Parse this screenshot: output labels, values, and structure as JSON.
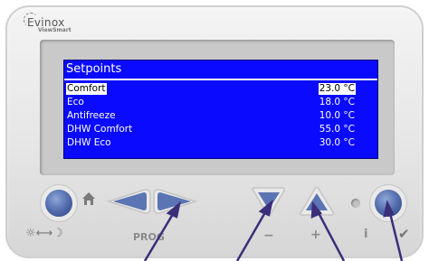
{
  "brand": {
    "name": "Evinox",
    "sub": "ViewSmart"
  },
  "screen": {
    "title": "Setpoints",
    "rows": [
      {
        "label": "Comfort",
        "value": "23.0 °C",
        "selected": true
      },
      {
        "label": "Eco",
        "value": "18.0 °C",
        "selected": false
      },
      {
        "label": "Antifreeze",
        "value": "10.0 °C",
        "selected": false
      },
      {
        "label": "DHW Comfort",
        "value": "55.0 °C",
        "selected": false
      },
      {
        "label": "DHW Eco",
        "value": "30.0 °C",
        "selected": false
      }
    ]
  },
  "labels": {
    "prog": "PROG",
    "minus": "−",
    "plus": "+",
    "info": "i",
    "check": "✔",
    "day_night": "☼⟷☽"
  },
  "colors": {
    "lcd_bg": "#0a0aff",
    "button_blue": "#4d67a8",
    "callout": "#3b2f7a"
  }
}
